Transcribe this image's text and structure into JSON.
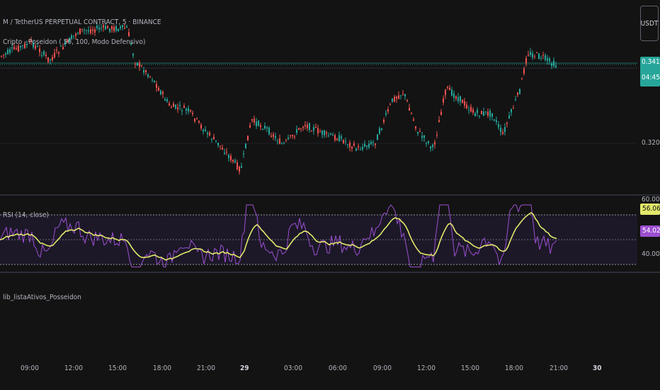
{
  "header": {
    "symbol_line": "M / TetherUS PERPETUAL CONTRACT, 5 · BINANCE",
    "indicator_line": "Cripto - Poseidon ( 50, 100, Modo Defensivo)"
  },
  "currency_button": "USDT",
  "price_axis": {
    "current_price": "0.3414",
    "countdown": "04:45",
    "tick": "0.3200",
    "accent_color": "#26a69a"
  },
  "rsi": {
    "label": "RSI (14, close)",
    "upper_value": "60.00",
    "lower_value": "40.00",
    "ma_value": "56.06",
    "rsi_value": "54.02",
    "ma_color": "#e2e86a",
    "rsi_color": "#9c4fd1"
  },
  "library_label": "lib_listaAtivos_Posseidon",
  "time_axis": [
    "09:00",
    "12:00",
    "15:00",
    "18:00",
    "21:00",
    "29",
    "03:00",
    "06:00",
    "09:00",
    "12:00",
    "15:00",
    "18:00",
    "21:00",
    "30"
  ],
  "chart_data": {
    "type": "candlestick",
    "price_reference": {
      "current": 0.3414,
      "tick": 0.32
    },
    "rsi_levels": {
      "upper": 60,
      "lower": 40
    },
    "rsi_ma_last": 56.06,
    "rsi_last": 54.02,
    "x": [
      "09:00",
      "12:00",
      "15:00",
      "18:00",
      "21:00",
      "29",
      "03:00",
      "06:00",
      "09:00",
      "12:00",
      "15:00",
      "18:00",
      "21:00",
      "30"
    ]
  }
}
